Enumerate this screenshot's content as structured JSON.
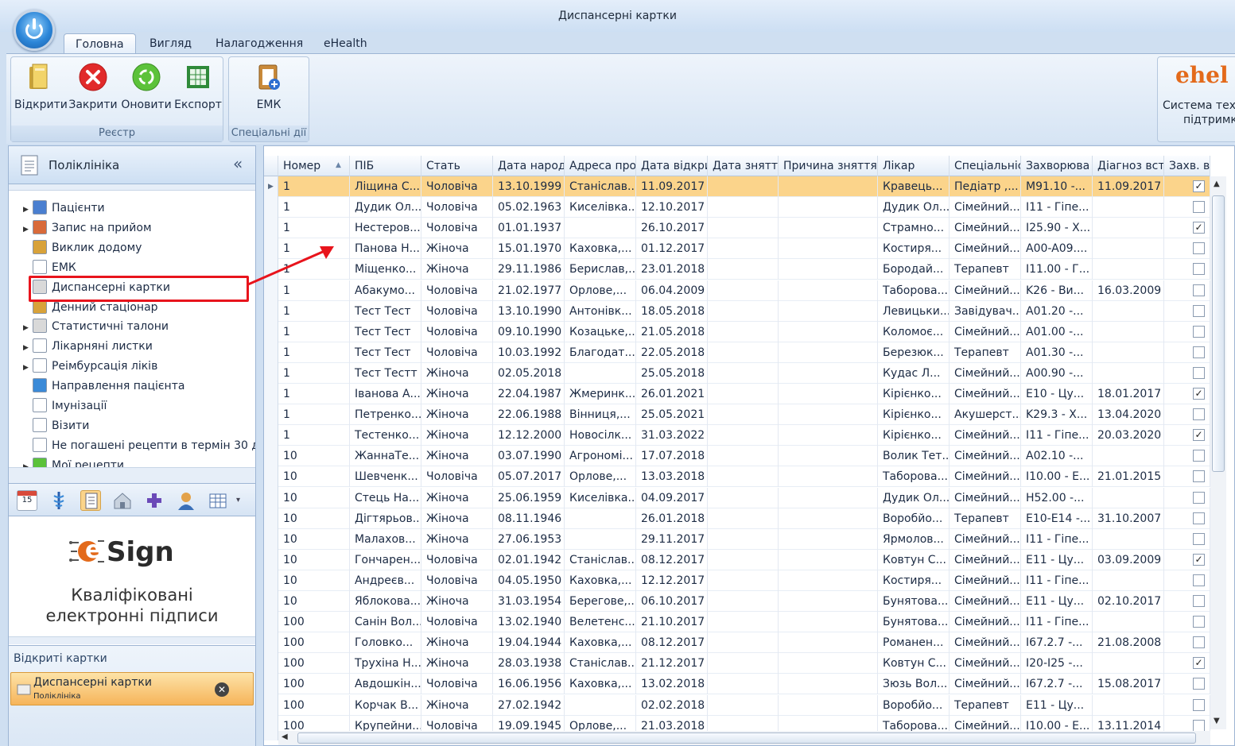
{
  "window": {
    "title": "Диспансерні картки"
  },
  "tabs": [
    "Головна",
    "Вигляд",
    "Налагодження",
    "eHealth"
  ],
  "ribbon": {
    "group1": {
      "caption": "Реєстр",
      "buttons": [
        "Відкрити",
        "Закрити",
        "Оновити",
        "Експорт"
      ]
    },
    "group2": {
      "caption": "Спеціальні дії",
      "buttons": [
        "ЕМК"
      ]
    },
    "ehealth": {
      "logo": "ehel",
      "label_line1": "Система техн",
      "label_line2": "підтримк"
    }
  },
  "left": {
    "header": "Поліклініка",
    "collapse": "«",
    "tree": [
      {
        "label": "Пацієнти",
        "arrow": true
      },
      {
        "label": "Запис на прийом",
        "arrow": true
      },
      {
        "label": "Виклик додому",
        "arrow": false
      },
      {
        "label": "ЕМК",
        "arrow": false
      },
      {
        "label": "Диспансерні картки",
        "arrow": false
      },
      {
        "label": "Денний стаціонар",
        "arrow": false
      },
      {
        "label": "Статистичні талони",
        "arrow": true
      },
      {
        "label": "Лікарняні листки",
        "arrow": true
      },
      {
        "label": "Реімбурсація ліків",
        "arrow": true
      },
      {
        "label": "Направлення пацієнта",
        "arrow": false
      },
      {
        "label": "Імунізації",
        "arrow": false
      },
      {
        "label": "Візити",
        "arrow": false
      },
      {
        "label": "Не погашені рецепти в термін 30 д",
        "arrow": false
      },
      {
        "label": "Мої рецепти",
        "arrow": true
      }
    ],
    "calendar_day": "15",
    "esign": {
      "brand_e": "e",
      "brand_rest": "Sign",
      "line1": "Кваліфіковані",
      "line2": "електронні підписи"
    },
    "open_cards": {
      "title": "Відкриті картки",
      "item_title": "Диспансерні картки",
      "item_sub": "Поліклініка"
    }
  },
  "grid": {
    "columns": [
      "Номер",
      "ПІБ",
      "Стать",
      "Дата народ",
      "Адреса про",
      "Дата відкри",
      "Дата зняття",
      "Причина зняття",
      "Лікар",
      "Спеціальніс",
      "Захворюва",
      "Діагноз вст",
      "Захв. ві"
    ],
    "rows": [
      [
        "1",
        "Ліщина С...",
        "Чоловіча",
        "13.10.1999",
        "Станіслав...",
        "11.09.2017",
        "",
        "",
        "Кравець...",
        "Педіатр ,...",
        "M91.10 -...",
        "11.09.2017",
        "1"
      ],
      [
        "1",
        "Дудик Ол...",
        "Чоловіча",
        "05.02.1963",
        "Киселівка...",
        "12.10.2017",
        "",
        "",
        "Дудик Ол...",
        "Сімейний...",
        "I11 -  Гіпе...",
        "",
        "0"
      ],
      [
        "1",
        "Нестеров...",
        "Чоловіча",
        "01.01.1937",
        "",
        "26.10.2017",
        "",
        "",
        "Страмно...",
        "Сімейний...",
        "I25.90 -  Х...",
        "",
        "1"
      ],
      [
        "1",
        "Панова Н...",
        "Жіноча",
        "15.01.1970",
        "Каховка,...",
        "01.12.2017",
        "",
        "",
        "Костиря...",
        "Сімейний...",
        "A00-A09....",
        "",
        "0"
      ],
      [
        "1",
        "Міщенко...",
        "Жіноча",
        "29.11.1986",
        "Берислав,...",
        "23.01.2018",
        "",
        "",
        "Бородай...",
        "Терапевт",
        "I11.00 -  Г...",
        "",
        "0"
      ],
      [
        "1",
        "Абакумо...",
        "Чоловіча",
        "21.02.1977",
        "Орлове,...",
        "06.04.2009",
        "",
        "",
        "Таборова...",
        "Сімейний...",
        "K26 -  Ви...",
        "16.03.2009",
        "0"
      ],
      [
        "1",
        "Тест Тест",
        "Чоловіча",
        "13.10.1990",
        "Антонівк...",
        "18.05.2018",
        "",
        "",
        "Левицьки...",
        "Завідувач...",
        "A01.20 -...",
        "",
        "0"
      ],
      [
        "1",
        "Тест Тест",
        "Чоловіча",
        "09.10.1990",
        "Козацьке,...",
        "21.05.2018",
        "",
        "",
        "Коломоє...",
        "Сімейний...",
        "A01.00 -...",
        "",
        "0"
      ],
      [
        "1",
        "Тест Тест",
        "Чоловіча",
        "10.03.1992",
        "Благодат...",
        "22.05.2018",
        "",
        "",
        "Березюк...",
        "Терапевт",
        "A01.30 -...",
        "",
        "0"
      ],
      [
        "1",
        "Тест Тестт",
        "Жіноча",
        "02.05.2018",
        "",
        "25.05.2018",
        "",
        "",
        "Кудас  Л...",
        "Сімейний...",
        "A00.90 -...",
        "",
        "0"
      ],
      [
        "1",
        "Іванова А...",
        "Жіноча",
        "22.04.1987",
        "Жмеринк...",
        "26.01.2021",
        "",
        "",
        "Кірієнко...",
        "Сімейний...",
        "E10 -  Цу...",
        "18.01.2017",
        "1"
      ],
      [
        "1",
        "Петренко...",
        "Жіноча",
        "22.06.1988",
        "Вінниця,...",
        "25.05.2021",
        "",
        "",
        "Кірієнко...",
        "Акушерст...",
        "K29.3 -  Х...",
        "13.04.2020",
        "0"
      ],
      [
        "1",
        "Тестенко...",
        "Жіноча",
        "12.12.2000",
        "Новосілк...",
        "31.03.2022",
        "",
        "",
        "Кірієнко...",
        "Сімейний...",
        "I11 -  Гіпе...",
        "20.03.2020",
        "1"
      ],
      [
        "10",
        "ЖаннаТе...",
        "Жіноча",
        "03.07.1990",
        "Агрономі...",
        "17.07.2018",
        "",
        "",
        "Волик Тет...",
        "Сімейний...",
        "A02.10 -...",
        "",
        "0"
      ],
      [
        "10",
        "Шевченк...",
        "Чоловіча",
        "05.07.2017",
        "Орлове,...",
        "13.03.2018",
        "",
        "",
        "Таборова...",
        "Сімейний...",
        "I10.00 -  Е...",
        "21.01.2015",
        "0"
      ],
      [
        "10",
        "Стець На...",
        "Жіноча",
        "25.06.1959",
        "Киселівка...",
        "04.09.2017",
        "",
        "",
        "Дудик Ол...",
        "Сімейний...",
        "H52.00 -...",
        "",
        "0"
      ],
      [
        "10",
        "Дігтярьов...",
        "Жіноча",
        "08.11.1946",
        "",
        "26.01.2018",
        "",
        "",
        "Воробйо...",
        "Терапевт",
        "E10-E14 -...",
        "31.10.2007",
        "0"
      ],
      [
        "10",
        "Малахов...",
        "Жіноча",
        "27.06.1953",
        "",
        "29.11.2017",
        "",
        "",
        "Ярмолов...",
        "Сімейний...",
        "I11 -  Гіпе...",
        "",
        "0"
      ],
      [
        "10",
        "Гончарен...",
        "Чоловіча",
        "02.01.1942",
        "Станіслав...",
        "08.12.2017",
        "",
        "",
        "Ковтун С...",
        "Сімейний...",
        "E11 -  Цу...",
        "03.09.2009",
        "1"
      ],
      [
        "10",
        "Андреєв...",
        "Чоловіча",
        "04.05.1950",
        "Каховка,...",
        "12.12.2017",
        "",
        "",
        "Костиря...",
        "Сімейний...",
        "I11 -  Гіпе...",
        "",
        "0"
      ],
      [
        "10",
        "Яблокова...",
        "Жіноча",
        "31.03.1954",
        "Берегове,...",
        "06.10.2017",
        "",
        "",
        "Бунятова...",
        "Сімейний...",
        "E11 -  Цу...",
        "02.10.2017",
        "0"
      ],
      [
        "100",
        "Санін Вол...",
        "Чоловіча",
        "13.02.1940",
        "Велетенс...",
        "21.10.2017",
        "",
        "",
        "Бунятова...",
        "Сімейний...",
        "I11 -  Гіпе...",
        "",
        "0"
      ],
      [
        "100",
        "Головко...",
        "Жіноча",
        "19.04.1944",
        "Каховка,...",
        "08.12.2017",
        "",
        "",
        "Романен...",
        "Сімейний...",
        "I67.2.7 -...",
        "21.08.2008",
        "0"
      ],
      [
        "100",
        "Трухіна Н...",
        "Жіноча",
        "28.03.1938",
        "Станіслав...",
        "21.12.2017",
        "",
        "",
        "Ковтун С...",
        "Сімейний...",
        "I20-I25 -...",
        "",
        "1"
      ],
      [
        "100",
        "Авдошкін...",
        "Чоловіча",
        "16.06.1956",
        "Каховка,...",
        "13.02.2018",
        "",
        "",
        "Зюзь Вол...",
        "Сімейний...",
        "I67.2.7 -...",
        "15.08.2017",
        "0"
      ],
      [
        "100",
        "Корчак В...",
        "Жіноча",
        "27.02.1942",
        "",
        "02.02.2018",
        "",
        "",
        "Воробйо...",
        "Терапевт",
        "E11 -  Цу...",
        "",
        "0"
      ],
      [
        "100",
        "Крупейни...",
        "Чоловіча",
        "19.09.1945",
        "Орлове,...",
        "21.03.2018",
        "",
        "",
        "Таборова...",
        "Сімейний...",
        "I10.00 -  Е...",
        "13.11.2014",
        "0"
      ]
    ]
  },
  "colors": {
    "selected_row": "#fbd48b",
    "highlight_box": "#e8141c",
    "arrow": "#e8141c"
  }
}
